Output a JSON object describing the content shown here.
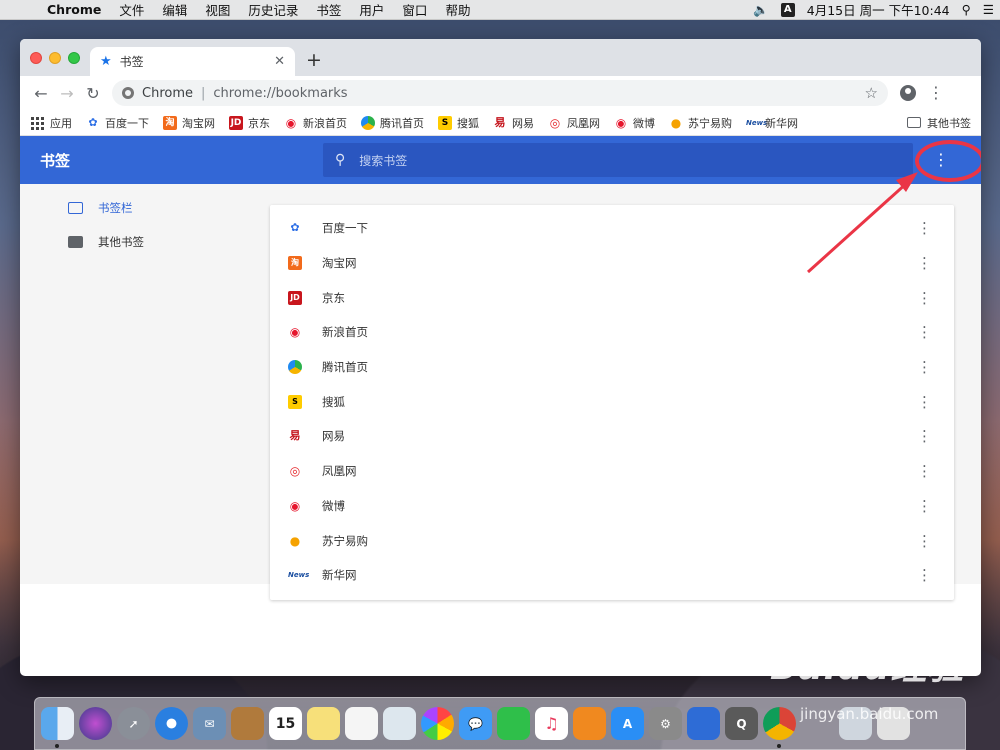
{
  "menubar": {
    "app_name": "Chrome",
    "items": [
      "文件",
      "编辑",
      "视图",
      "历史记录",
      "书签",
      "用户",
      "窗口",
      "帮助"
    ],
    "ime": "A",
    "datetime": "4月15日 周一 下午10:44"
  },
  "tab": {
    "title": "书签"
  },
  "toolbar": {
    "site_label": "Chrome",
    "separator": "|",
    "url": "chrome://bookmarks"
  },
  "bookmarks_bar": {
    "apps_label": "应用",
    "items": [
      {
        "label": "百度一下",
        "fav": "✿"
      },
      {
        "label": "淘宝网",
        "fav": "淘"
      },
      {
        "label": "京东",
        "fav": "JD"
      },
      {
        "label": "新浪首页",
        "fav": "◉"
      },
      {
        "label": "腾讯首页",
        "fav": ""
      },
      {
        "label": "搜狐",
        "fav": "S"
      },
      {
        "label": "网易",
        "fav": "易"
      },
      {
        "label": "凤凰网",
        "fav": "◎"
      },
      {
        "label": "微博",
        "fav": "◉"
      },
      {
        "label": "苏宁易购",
        "fav": "●"
      },
      {
        "label": "新华网",
        "fav": "News"
      }
    ],
    "other_label": "其他书签"
  },
  "manager": {
    "title": "书签",
    "search_placeholder": "搜索书签",
    "sidebar": [
      {
        "label": "书签栏",
        "active": true
      },
      {
        "label": "其他书签",
        "active": false
      }
    ],
    "list": [
      {
        "label": "百度一下",
        "fav": "✿"
      },
      {
        "label": "淘宝网",
        "fav": "淘"
      },
      {
        "label": "京东",
        "fav": "JD"
      },
      {
        "label": "新浪首页",
        "fav": "◉"
      },
      {
        "label": "腾讯首页",
        "fav": ""
      },
      {
        "label": "搜狐",
        "fav": "S"
      },
      {
        "label": "网易",
        "fav": "易"
      },
      {
        "label": "凤凰网",
        "fav": "◎"
      },
      {
        "label": "微博",
        "fav": "◉"
      },
      {
        "label": "苏宁易购",
        "fav": "●"
      },
      {
        "label": "新华网",
        "fav": "News"
      }
    ]
  },
  "dock": {
    "calendar_day": "15"
  },
  "watermark": {
    "text": "Baidu经验",
    "url": "jingyan.baidu.com"
  },
  "colors": {
    "header_blue": "#3367d6",
    "annotation_red": "#ea3546"
  }
}
